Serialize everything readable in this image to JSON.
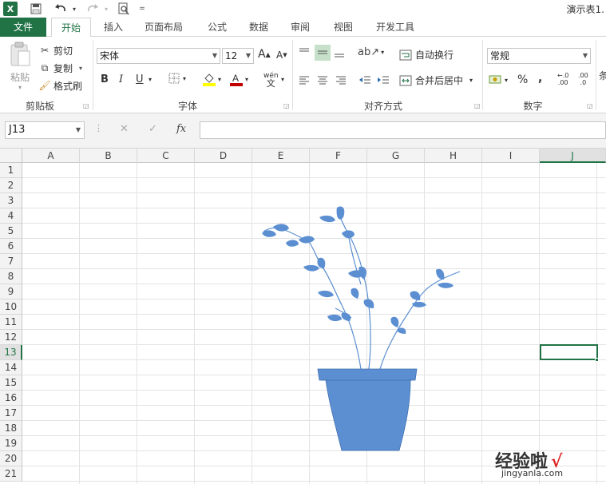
{
  "titlebar": {
    "logo": "X",
    "save_icon": "save-icon",
    "undo_icon": "undo-icon",
    "redo_icon": "redo-icon",
    "preview_icon": "print-preview-icon",
    "customize_glyph": "=",
    "title": "演示表1."
  },
  "tabs": [
    {
      "label": "文件"
    },
    {
      "label": "开始"
    },
    {
      "label": "插入"
    },
    {
      "label": "页面布局"
    },
    {
      "label": "公式"
    },
    {
      "label": "数据"
    },
    {
      "label": "审阅"
    },
    {
      "label": "视图"
    },
    {
      "label": "开发工具"
    }
  ],
  "ribbon": {
    "clipboard": {
      "label": "剪贴板",
      "paste": "粘贴",
      "cut": "剪切",
      "copy": "复制",
      "format_painter": "格式刷"
    },
    "font": {
      "label": "字体",
      "font_name": "宋体",
      "font_size": "12",
      "grow": "A",
      "shrink": "A",
      "bold": "B",
      "italic": "I",
      "underline": "U",
      "phonetic": "wén"
    },
    "alignment": {
      "label": "对齐方式",
      "wrap": "自动换行",
      "merge": "合并后居中"
    },
    "number": {
      "label": "数字",
      "format": "常规",
      "percent": "%",
      "comma": ",",
      "inc_decimal": ".00",
      "dec_decimal": ".0"
    },
    "styles": {
      "partial": "条"
    }
  },
  "formula_bar": {
    "name_box": "J13",
    "cancel": "✕",
    "enter": "✓",
    "fx": "fx",
    "value": ""
  },
  "sheet": {
    "columns": [
      "A",
      "B",
      "C",
      "D",
      "E",
      "F",
      "G",
      "H",
      "I",
      "J"
    ],
    "rows": [
      "1",
      "2",
      "3",
      "4",
      "5",
      "6",
      "7",
      "8",
      "9",
      "10",
      "11",
      "12",
      "13",
      "14",
      "15",
      "16",
      "17",
      "18",
      "19",
      "20",
      "21"
    ],
    "selected_column": "J",
    "selected_row": "13"
  },
  "colors": {
    "accent": "#217346",
    "drawing": "#5b8fd1"
  },
  "watermark": {
    "line1": "经验啦",
    "check": "√",
    "line2": "jingyanla.com"
  }
}
